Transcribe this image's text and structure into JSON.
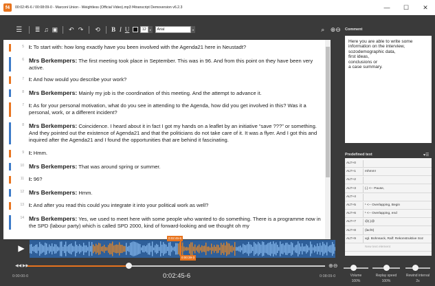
{
  "window": {
    "app_icon_text": "f4",
    "title": "00:02:45-6 / 00:08:09-0 - Marconi Union - Weightless (Official Video).mp3 f4transcript Demoversion v6.2.3",
    "controls": [
      "—",
      "☐",
      "✕"
    ]
  },
  "toolbar": {
    "menu_icon": "☰",
    "doc_icon": "≣",
    "music_icon": "♫",
    "save_icon": "▣",
    "undo_icon": "↶",
    "redo_icon": "↷",
    "sync_icon": "⟲",
    "bold": "B",
    "italic": "I",
    "underline": "U",
    "font_size": "12",
    "font_name": "Arial",
    "search_icon": "⌕",
    "zoom_icon": "⊕⊖",
    "text_color": "#111111"
  },
  "transcript": {
    "rows": [
      {
        "num": "5",
        "speaker": "I:",
        "text": "To start with: how long exactly have you been involved with the Agenda21 here in Neustadt?",
        "color": "#e8741e"
      },
      {
        "num": "6",
        "speaker": "Mrs Berkempers:",
        "text": "The first meeting took place in September. This was in 96. And from this point on they have been very active.",
        "color": "#3c7ac8"
      },
      {
        "num": "7",
        "speaker": "I:",
        "text": "And how would you describe your work?",
        "color": "#e8741e"
      },
      {
        "num": "8",
        "speaker": "Mrs Berkempers:",
        "text": "Mainly my job is the coordination of this meeting. And the attempt to advance it.",
        "color": "#3c7ac8"
      },
      {
        "num": "7",
        "speaker": "I:",
        "text": "As for your personal motivation, what do you see in attending to the Agenda, how did you get involved in this? Was it a personal, work, or a different incident?",
        "color": "#e8741e"
      },
      {
        "num": "8",
        "speaker": "Mrs Berkempers:",
        "text": "Coincidence. I heard about it in fact I got my hands on a leaflet by an initiative “save ???” or something. And they pointed out the existence of Agenda21 and that the politicians do not take care of it. It was a flyer. And I got this and inquired after the Agenda21 and I found the opportunities that are behind it fascinating.",
        "color": "#3c7ac8"
      },
      {
        "num": "9",
        "speaker": "I:",
        "text": "Hmm.",
        "color": "#e8741e"
      },
      {
        "num": "10",
        "speaker": "Mrs Berkempers:",
        "text": "That was around spring or summer.",
        "color": "#3c7ac8"
      },
      {
        "num": "11",
        "speaker": "I:",
        "text": "96?",
        "color": "#e8741e"
      },
      {
        "num": "12",
        "speaker": "Mrs Berkempers:",
        "text": "Hmm.",
        "color": "#3c7ac8"
      },
      {
        "num": "13",
        "speaker": "I:",
        "text": "And after you read this could you integrate it into your political work as well?",
        "color": "#e8741e"
      },
      {
        "num": "14",
        "speaker": "Mrs Berkempers:",
        "text": "Yes, we used to meet here with some people who wanted to do something. There is a programme now in the SPD (labour party) which is called SPD 2000, kind of forward-looking and we thought oh my",
        "color": "#3c7ac8"
      }
    ]
  },
  "player": {
    "play_icon": "▶",
    "marker_top": "0:02:45-6",
    "marker_bottom": "0:00:39-3",
    "ff_icons": "◀◀ ▶▶",
    "seek_icon": "⊕⊖",
    "position_fraction": 0.34,
    "time_start": "0:00:00-0",
    "time_current": "0:02:45-6",
    "time_end": "0:08:09-0"
  },
  "comment": {
    "title": "Comment",
    "text": "Here you are able to write some\ninformation on the interview,\nsozodemographic data,\nfirst ideas,\nconclusions or\na case summary."
  },
  "predefined": {
    "title": "Predefined text",
    "icons": "▾☰",
    "rows": [
      {
        "key": "ALT+0",
        "value": ""
      },
      {
        "key": "ALT+1",
        "value": "mhmm!"
      },
      {
        "key": "ALT+2",
        "value": ""
      },
      {
        "key": "ALT+3",
        "value": "(.) <-- Pause,"
      },
      {
        "key": "ALT+4",
        "value": ""
      },
      {
        "key": "ALT+5",
        "value": "¹ <-- Overlapping, Begin"
      },
      {
        "key": "ALT+6",
        "value": "¹ <-- Overlapping, end"
      },
      {
        "key": "ALT+7",
        "value": "@(.)@"
      },
      {
        "key": "ALT+8",
        "value": "(lacht)"
      },
      {
        "key": "ALT+9",
        "value": "vgl. Bohnsack, Ralf: Rekonstruktive Soz"
      }
    ],
    "new_placeholder": "New text element"
  },
  "sliders": [
    {
      "name": "Volume",
      "value": "100%",
      "fraction": 0.4
    },
    {
      "name": "Replay speed",
      "value": "100%",
      "fraction": 0.5
    },
    {
      "name": "Rewind interval",
      "value": "2s",
      "fraction": 0.4
    }
  ],
  "colors": {
    "accent": "#e8741e",
    "speaker_interviewer": "#e8741e",
    "speaker_respondent": "#3c7ac8",
    "background": "#3a3a3a",
    "waveform": "#2f5f99"
  }
}
